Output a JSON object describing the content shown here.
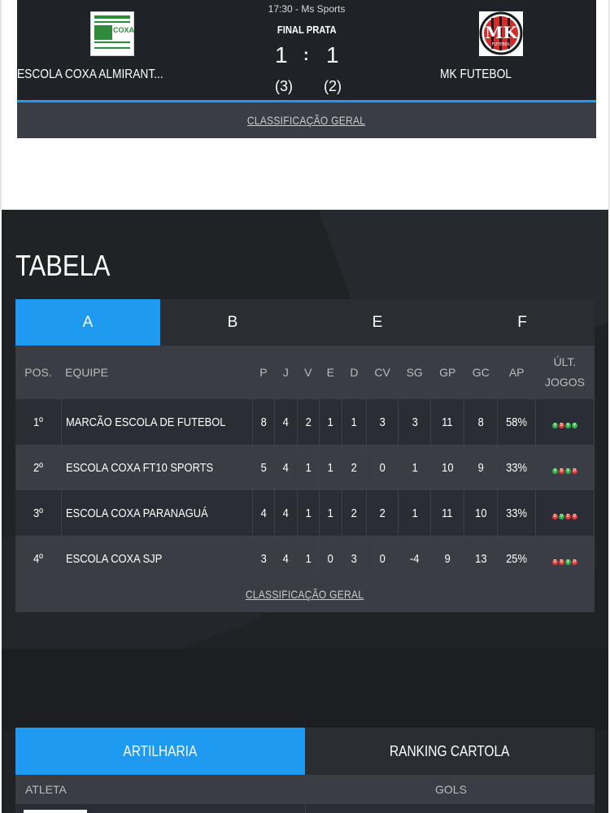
{
  "match": {
    "time_venue": "17:30 - Ms Sports",
    "stage": "FINAL PRATA",
    "home_score": "1",
    "away_score": "1",
    "separator": ":",
    "home_penalties": "(3)",
    "away_penalties": "(2)",
    "home_team": "ESCOLA COXA ALMIRANT...",
    "away_team": "MK FUTEBOL",
    "home_logo_text": "COXA",
    "away_logo_text": "MK",
    "away_logo_subtext": "FUTEBOL",
    "footer_link": "CLASSIFICAÇÃO GERAL"
  },
  "standings": {
    "title": "TABELA",
    "groups": [
      "A",
      "B",
      "E",
      "F"
    ],
    "active_group": "A",
    "columns": {
      "pos": "POS.",
      "team": "EQUIPE",
      "p": "P",
      "j": "J",
      "v": "V",
      "e": "E",
      "d": "D",
      "cv": "CV",
      "sg": "SG",
      "gp": "GP",
      "gc": "GC",
      "ap": "AP",
      "last1": "ÚLT.",
      "last2": "JOGOS"
    },
    "rows": [
      {
        "pos": "1º",
        "team": "MARCÃO ESCOLA DE FUTEBOL",
        "p": "8",
        "j": "4",
        "v": "2",
        "e": "1",
        "d": "1",
        "cv": "3",
        "sg": "3",
        "gp": "11",
        "gc": "8",
        "ap": "58%",
        "form": [
          "V",
          "D",
          "V",
          "V"
        ]
      },
      {
        "pos": "2º",
        "team": "ESCOLA COXA FT10 SPORTS",
        "p": "5",
        "j": "4",
        "v": "1",
        "e": "1",
        "d": "2",
        "cv": "0",
        "sg": "1",
        "gp": "10",
        "gc": "9",
        "ap": "33%",
        "form": [
          "V",
          "D",
          "V",
          "D"
        ]
      },
      {
        "pos": "3º",
        "team": "ESCOLA COXA PARANAGUÁ",
        "p": "4",
        "j": "4",
        "v": "1",
        "e": "1",
        "d": "2",
        "cv": "2",
        "sg": "1",
        "gp": "11",
        "gc": "10",
        "ap": "33%",
        "form": [
          "D",
          "V",
          "D",
          "D"
        ]
      },
      {
        "pos": "4º",
        "team": "ESCOLA COXA SJP",
        "p": "3",
        "j": "4",
        "v": "1",
        "e": "0",
        "d": "3",
        "cv": "0",
        "sg": "-4",
        "gp": "9",
        "gc": "13",
        "ap": "25%",
        "form": [
          "D",
          "D",
          "V",
          "D"
        ]
      }
    ],
    "footer_link": "CLASSIFICAÇÃO GERAL"
  },
  "stats_tabs": {
    "tab1": "ARTILHARIA",
    "tab2": "RANKING CARTOLA",
    "header_athlete": "ATLETA",
    "header_goals": "GOLS"
  },
  "colors": {
    "accent": "#1e9bf0",
    "win": "#2fb34a",
    "loss": "#e53935"
  }
}
